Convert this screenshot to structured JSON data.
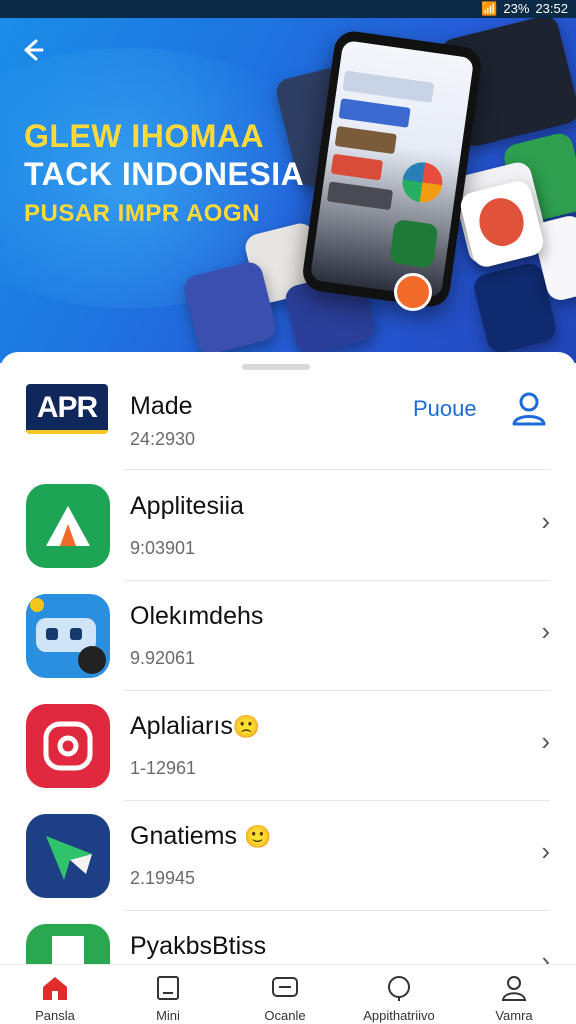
{
  "status_bar": {
    "battery": "23%",
    "time": "23:52"
  },
  "hero": {
    "back_icon": "arrow-left-icon",
    "line1": "GLEW IHOMAA",
    "line2": "TACK INDONESIA",
    "line3": "PUSAR IMPR AOGN",
    "colors": {
      "accent": "#ffd83a",
      "bg_start": "#1b8de8",
      "bg_end": "#2245b8"
    }
  },
  "header_item": {
    "logo_text": "APR",
    "title": "Made",
    "subtitle": "24:2930",
    "action_link": "Puoue",
    "action_icon": "person-icon"
  },
  "apps": [
    {
      "name": "Applitesiia",
      "sub": "9:03901",
      "icon": "green-triangle-app-icon"
    },
    {
      "name": "Olekımdehs",
      "sub": "9.92061",
      "icon": "robot-app-icon"
    },
    {
      "name": "Aplaliarıs",
      "sub": "1-12961",
      "icon": "red-camera-app-icon",
      "emoji": "🙁"
    },
    {
      "name": "Gnatiems",
      "sub": "2.19945",
      "icon": "star-arrow-app-icon",
      "emoji": "🙂"
    },
    {
      "name": "PyakbsBtiss",
      "sub": "",
      "icon": "green-home-app-icon"
    }
  ],
  "bottom_nav": [
    {
      "label": "Pansla",
      "icon": "home-icon",
      "active": true
    },
    {
      "label": "Mini",
      "icon": "tablet-icon",
      "active": false
    },
    {
      "label": "Ocanle",
      "icon": "message-icon",
      "active": false
    },
    {
      "label": "Appithatriivo",
      "icon": "refresh-icon",
      "active": false
    },
    {
      "label": "Vamra",
      "icon": "person-icon",
      "active": false
    }
  ],
  "accent_color": "#1d6ad9"
}
